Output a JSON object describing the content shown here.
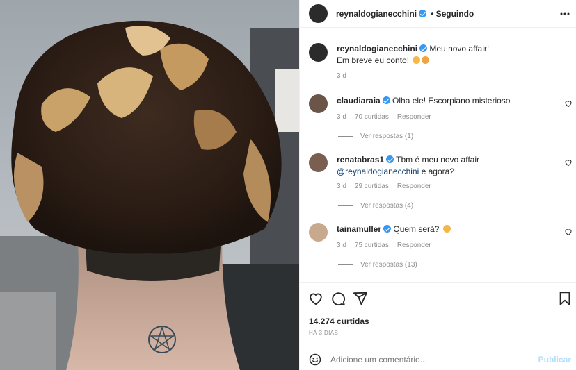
{
  "post": {
    "author": "reynaldogianecchini",
    "follow_status": "Seguindo",
    "more_icon": "more-dots-icon",
    "caption_line1": "Meu novo affair!",
    "caption_line2": "Em breve eu conto!",
    "caption_time": "3 d"
  },
  "comments": [
    {
      "user": "claudiaraia",
      "text": "Olha ele! Escorpiano misterioso",
      "time": "3 d",
      "likes": "70 curtidas",
      "reply": "Responder",
      "view_replies": "Ver respostas (1)"
    },
    {
      "user": "renatabras1",
      "text_before": "Tbm é meu novo affair ",
      "mention": "@reynaldogianecchini",
      "text_after": " e agora?",
      "time": "3 d",
      "likes": "29 curtidas",
      "reply": "Responder",
      "view_replies": "Ver respostas (4)"
    },
    {
      "user": "tainamuller",
      "text": "Quem será?",
      "time": "3 d",
      "likes": "75 curtidas",
      "reply": "Responder",
      "view_replies": "Ver respostas (13)"
    }
  ],
  "actions": {
    "like_icon": "heart-icon",
    "comment_icon": "comment-bubble-icon",
    "share_icon": "share-paper-plane-icon",
    "save_icon": "bookmark-icon",
    "likes_count": "14.274 curtidas",
    "date": "HÁ 3 DIAS"
  },
  "add_comment": {
    "placeholder": "Adicione um comentário...",
    "publish_label": "Publicar",
    "emoji_icon": "smiley-icon"
  },
  "colors": {
    "verified": "#3897f0",
    "mention": "#00376b",
    "publish_disabled": "#b2dffc",
    "secondary_text": "#8e8e8e"
  }
}
